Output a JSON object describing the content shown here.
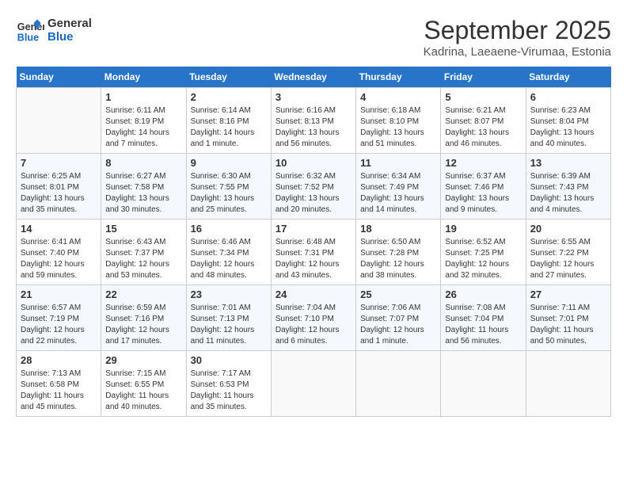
{
  "header": {
    "logo_line1": "General",
    "logo_line2": "Blue",
    "month_title": "September 2025",
    "subtitle": "Kadrina, Laeaene-Virumaa, Estonia"
  },
  "weekdays": [
    "Sunday",
    "Monday",
    "Tuesday",
    "Wednesday",
    "Thursday",
    "Friday",
    "Saturday"
  ],
  "weeks": [
    [
      {
        "day": "",
        "sunrise": "",
        "sunset": "",
        "daylight": ""
      },
      {
        "day": "1",
        "sunrise": "Sunrise: 6:11 AM",
        "sunset": "Sunset: 8:19 PM",
        "daylight": "Daylight: 14 hours and 7 minutes."
      },
      {
        "day": "2",
        "sunrise": "Sunrise: 6:14 AM",
        "sunset": "Sunset: 8:16 PM",
        "daylight": "Daylight: 14 hours and 1 minute."
      },
      {
        "day": "3",
        "sunrise": "Sunrise: 6:16 AM",
        "sunset": "Sunset: 8:13 PM",
        "daylight": "Daylight: 13 hours and 56 minutes."
      },
      {
        "day": "4",
        "sunrise": "Sunrise: 6:18 AM",
        "sunset": "Sunset: 8:10 PM",
        "daylight": "Daylight: 13 hours and 51 minutes."
      },
      {
        "day": "5",
        "sunrise": "Sunrise: 6:21 AM",
        "sunset": "Sunset: 8:07 PM",
        "daylight": "Daylight: 13 hours and 46 minutes."
      },
      {
        "day": "6",
        "sunrise": "Sunrise: 6:23 AM",
        "sunset": "Sunset: 8:04 PM",
        "daylight": "Daylight: 13 hours and 40 minutes."
      }
    ],
    [
      {
        "day": "7",
        "sunrise": "Sunrise: 6:25 AM",
        "sunset": "Sunset: 8:01 PM",
        "daylight": "Daylight: 13 hours and 35 minutes."
      },
      {
        "day": "8",
        "sunrise": "Sunrise: 6:27 AM",
        "sunset": "Sunset: 7:58 PM",
        "daylight": "Daylight: 13 hours and 30 minutes."
      },
      {
        "day": "9",
        "sunrise": "Sunrise: 6:30 AM",
        "sunset": "Sunset: 7:55 PM",
        "daylight": "Daylight: 13 hours and 25 minutes."
      },
      {
        "day": "10",
        "sunrise": "Sunrise: 6:32 AM",
        "sunset": "Sunset: 7:52 PM",
        "daylight": "Daylight: 13 hours and 20 minutes."
      },
      {
        "day": "11",
        "sunrise": "Sunrise: 6:34 AM",
        "sunset": "Sunset: 7:49 PM",
        "daylight": "Daylight: 13 hours and 14 minutes."
      },
      {
        "day": "12",
        "sunrise": "Sunrise: 6:37 AM",
        "sunset": "Sunset: 7:46 PM",
        "daylight": "Daylight: 13 hours and 9 minutes."
      },
      {
        "day": "13",
        "sunrise": "Sunrise: 6:39 AM",
        "sunset": "Sunset: 7:43 PM",
        "daylight": "Daylight: 13 hours and 4 minutes."
      }
    ],
    [
      {
        "day": "14",
        "sunrise": "Sunrise: 6:41 AM",
        "sunset": "Sunset: 7:40 PM",
        "daylight": "Daylight: 12 hours and 59 minutes."
      },
      {
        "day": "15",
        "sunrise": "Sunrise: 6:43 AM",
        "sunset": "Sunset: 7:37 PM",
        "daylight": "Daylight: 12 hours and 53 minutes."
      },
      {
        "day": "16",
        "sunrise": "Sunrise: 6:46 AM",
        "sunset": "Sunset: 7:34 PM",
        "daylight": "Daylight: 12 hours and 48 minutes."
      },
      {
        "day": "17",
        "sunrise": "Sunrise: 6:48 AM",
        "sunset": "Sunset: 7:31 PM",
        "daylight": "Daylight: 12 hours and 43 minutes."
      },
      {
        "day": "18",
        "sunrise": "Sunrise: 6:50 AM",
        "sunset": "Sunset: 7:28 PM",
        "daylight": "Daylight: 12 hours and 38 minutes."
      },
      {
        "day": "19",
        "sunrise": "Sunrise: 6:52 AM",
        "sunset": "Sunset: 7:25 PM",
        "daylight": "Daylight: 12 hours and 32 minutes."
      },
      {
        "day": "20",
        "sunrise": "Sunrise: 6:55 AM",
        "sunset": "Sunset: 7:22 PM",
        "daylight": "Daylight: 12 hours and 27 minutes."
      }
    ],
    [
      {
        "day": "21",
        "sunrise": "Sunrise: 6:57 AM",
        "sunset": "Sunset: 7:19 PM",
        "daylight": "Daylight: 12 hours and 22 minutes."
      },
      {
        "day": "22",
        "sunrise": "Sunrise: 6:59 AM",
        "sunset": "Sunset: 7:16 PM",
        "daylight": "Daylight: 12 hours and 17 minutes."
      },
      {
        "day": "23",
        "sunrise": "Sunrise: 7:01 AM",
        "sunset": "Sunset: 7:13 PM",
        "daylight": "Daylight: 12 hours and 11 minutes."
      },
      {
        "day": "24",
        "sunrise": "Sunrise: 7:04 AM",
        "sunset": "Sunset: 7:10 PM",
        "daylight": "Daylight: 12 hours and 6 minutes."
      },
      {
        "day": "25",
        "sunrise": "Sunrise: 7:06 AM",
        "sunset": "Sunset: 7:07 PM",
        "daylight": "Daylight: 12 hours and 1 minute."
      },
      {
        "day": "26",
        "sunrise": "Sunrise: 7:08 AM",
        "sunset": "Sunset: 7:04 PM",
        "daylight": "Daylight: 11 hours and 56 minutes."
      },
      {
        "day": "27",
        "sunrise": "Sunrise: 7:11 AM",
        "sunset": "Sunset: 7:01 PM",
        "daylight": "Daylight: 11 hours and 50 minutes."
      }
    ],
    [
      {
        "day": "28",
        "sunrise": "Sunrise: 7:13 AM",
        "sunset": "Sunset: 6:58 PM",
        "daylight": "Daylight: 11 hours and 45 minutes."
      },
      {
        "day": "29",
        "sunrise": "Sunrise: 7:15 AM",
        "sunset": "Sunset: 6:55 PM",
        "daylight": "Daylight: 11 hours and 40 minutes."
      },
      {
        "day": "30",
        "sunrise": "Sunrise: 7:17 AM",
        "sunset": "Sunset: 6:53 PM",
        "daylight": "Daylight: 11 hours and 35 minutes."
      },
      {
        "day": "",
        "sunrise": "",
        "sunset": "",
        "daylight": ""
      },
      {
        "day": "",
        "sunrise": "",
        "sunset": "",
        "daylight": ""
      },
      {
        "day": "",
        "sunrise": "",
        "sunset": "",
        "daylight": ""
      },
      {
        "day": "",
        "sunrise": "",
        "sunset": "",
        "daylight": ""
      }
    ]
  ]
}
